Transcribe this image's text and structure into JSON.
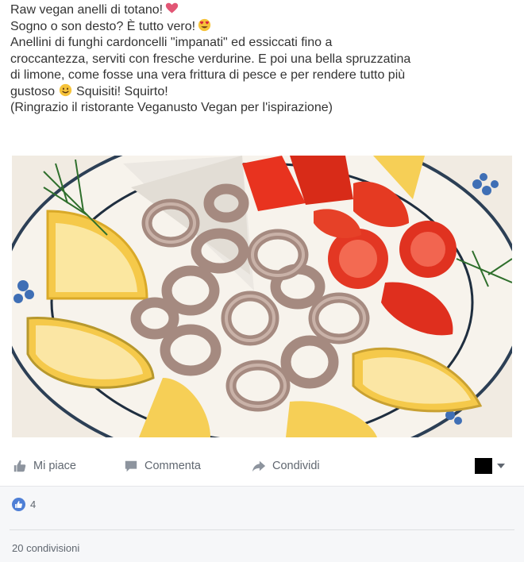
{
  "post": {
    "lines": [
      "Raw vegan anelli di totano!",
      "Sogno o son desto? È tutto vero!",
      "Anellini di funghi cardoncelli \"impanati\" ed essiccati fino a",
      "croccantezza, serviti con fresche verdurine. E poi una bella spruzzatina",
      "di limone, come fosse una vera frittura di pesce e per rendere tutto più",
      "gustoso",
      "Squisiti! Squirto!",
      "(Ringrazio il ristorante Veganusto Vegan per l'ispirazione)"
    ],
    "emojis": [
      "heart-emoji",
      "heart-eyes-emoji",
      "smile-emoji"
    ]
  },
  "photo": {
    "subject": "",
    "icon": "food-photo"
  },
  "actions": {
    "like_label": "Mi piace",
    "comment_label": "Commenta",
    "share_label": "Condividi"
  },
  "reactions": {
    "count": "4"
  },
  "shares": {
    "label": "20 condivisioni"
  },
  "colors": {
    "like_blue": "#4e7fd6",
    "text": "#333333",
    "meta": "#606770",
    "heart": "#e25675"
  }
}
